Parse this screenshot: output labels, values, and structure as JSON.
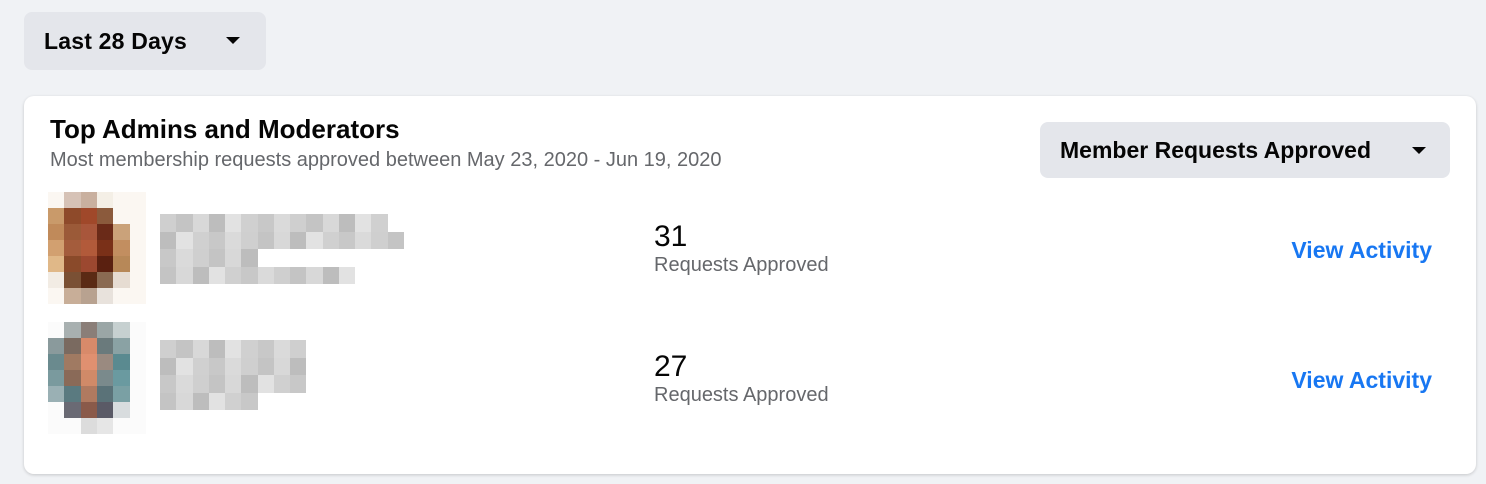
{
  "range_filter": {
    "label": "Last 28 Days",
    "icon": "caret-down-icon"
  },
  "card": {
    "title": "Top Admins and Moderators",
    "subtitle": "Most membership requests approved between May 23, 2020 - Jun 19, 2020",
    "metric_filter": {
      "label": "Member Requests Approved",
      "icon": "caret-down-icon"
    }
  },
  "rows": [
    {
      "count": "31",
      "caption": "Requests Approved",
      "link": "View Activity"
    },
    {
      "count": "27",
      "caption": "Requests Approved",
      "link": "View Activity"
    }
  ],
  "colors": {
    "background": "#f0f2f5",
    "button_bg": "#e4e6eb",
    "link": "#1877f2",
    "secondary_text": "#65676b"
  }
}
